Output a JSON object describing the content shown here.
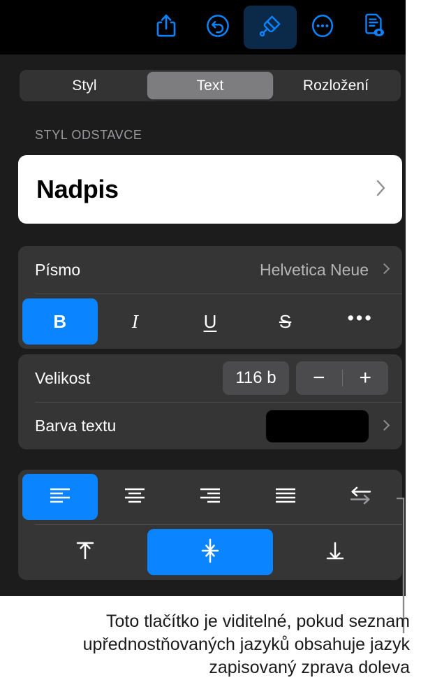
{
  "toolbar": {
    "buttons": [
      {
        "name": "share-icon",
        "label": "Sdílet"
      },
      {
        "name": "undo-icon",
        "label": "Zpět"
      },
      {
        "name": "brush-icon",
        "label": "Formát",
        "active": true
      },
      {
        "name": "more-icon",
        "label": "Více"
      },
      {
        "name": "document-view-icon",
        "label": "Dokument"
      }
    ]
  },
  "segmented": {
    "items": [
      {
        "label": "Styl",
        "selected": false
      },
      {
        "label": "Text",
        "selected": true
      },
      {
        "label": "Rozložení",
        "selected": false
      }
    ]
  },
  "paragraph": {
    "section_label": "STYL ODSTAVCE",
    "style_name": "Nadpis",
    "chevron_icon": "chevron-right-icon"
  },
  "font": {
    "label": "Písmo",
    "value": "Helvetica Neue",
    "chevron_icon": "chevron-right-icon",
    "format_buttons": [
      {
        "name": "bold-button",
        "label": "B",
        "active": true
      },
      {
        "name": "italic-button",
        "label": "I",
        "active": false
      },
      {
        "name": "underline-button",
        "label": "U",
        "active": false
      },
      {
        "name": "strikethrough-button",
        "label": "S",
        "active": false
      },
      {
        "name": "more-format-button",
        "label": "•••",
        "active": false
      }
    ]
  },
  "size": {
    "label": "Velikost",
    "value": "116 b",
    "decrement": "−",
    "increment": "+"
  },
  "text_color": {
    "label": "Barva textu",
    "swatch_hex": "#000000",
    "chevron_icon": "chevron-right-icon"
  },
  "alignment": {
    "buttons": [
      {
        "name": "align-left-button",
        "label": "Zarovnat vlevo",
        "active": true
      },
      {
        "name": "align-center-button",
        "label": "Zarovnat na střed",
        "active": false
      },
      {
        "name": "align-right-button",
        "label": "Zarovnat vpravo",
        "active": false
      },
      {
        "name": "align-justify-button",
        "label": "Do bloku",
        "active": false
      },
      {
        "name": "text-direction-button",
        "label": "Směr textu",
        "active": false
      }
    ],
    "vertical_buttons": [
      {
        "name": "valign-top-button",
        "label": "Nahoru",
        "active": false
      },
      {
        "name": "valign-middle-button",
        "label": "Na střed",
        "active": true
      },
      {
        "name": "valign-bottom-button",
        "label": "Dolů",
        "active": false
      }
    ]
  },
  "caption": {
    "text": "Toto tlačítko je viditelné, pokud seznam upřednostňovaných jazyků obsahuje jazyk zapisovaný zprava doleva"
  },
  "colors": {
    "accent": "#0a84ff",
    "panel_bg": "#1c1c1c",
    "card_bg": "#353535",
    "toolbar_bg": "#000000",
    "segment_selected": "#7d7d80"
  }
}
